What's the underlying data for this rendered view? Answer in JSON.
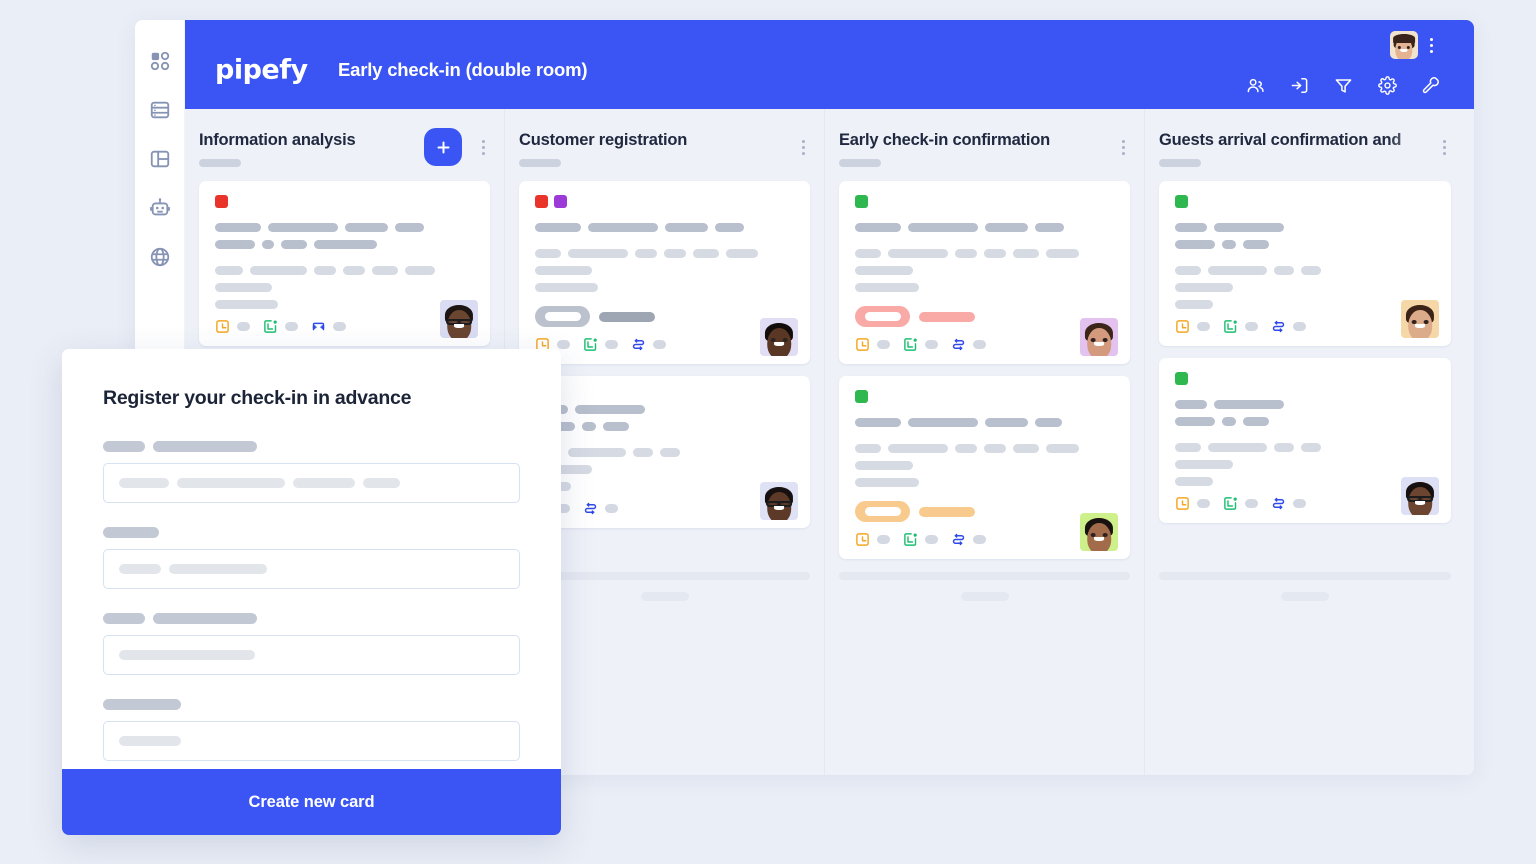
{
  "app": {
    "brand": "pipefy",
    "board_title": "Early check-in (double room)",
    "accent_color": "#3b55f4",
    "background_color": "#eaeef6",
    "board_background": "#eef1f8"
  },
  "sidebar": {
    "items": [
      {
        "icon": "grid-dashboard-icon",
        "name": "sidebar-item-dashboard"
      },
      {
        "icon": "database-icon",
        "name": "sidebar-item-database"
      },
      {
        "icon": "kanban-layout-icon",
        "name": "sidebar-item-board"
      },
      {
        "icon": "robot-automation-icon",
        "name": "sidebar-item-automation"
      },
      {
        "icon": "globe-icon",
        "name": "sidebar-item-public"
      }
    ]
  },
  "topbar": {
    "avatar_name": "user-avatar",
    "kebab_name": "board-options-kebab",
    "tools": [
      {
        "icon": "members-icon",
        "name": "tool-members"
      },
      {
        "icon": "archive-import-icon",
        "name": "tool-archive"
      },
      {
        "icon": "filter-icon",
        "name": "tool-filter"
      },
      {
        "icon": "gear-icon",
        "name": "tool-settings"
      },
      {
        "icon": "wrench-icon",
        "name": "tool-tools"
      }
    ]
  },
  "columns": [
    {
      "title": "Information analysis",
      "has_add_button": true,
      "add_label": "+",
      "truncated": false,
      "cards": [
        {
          "labels": [
            "#e8342a"
          ],
          "badge": null,
          "footer_icons": [
            "clock-square-icon",
            "calendar-check-icon",
            "connection-flow-icon"
          ],
          "avatar": "avatar-man-glasses",
          "avatar_bg": "#d9dcf2",
          "skin": "#6a4530",
          "hair": "#1d1512"
        }
      ]
    },
    {
      "title": "Customer registration",
      "has_add_button": false,
      "truncated": false,
      "cards": [
        {
          "labels": [
            "#e8342a",
            "#9b3ad6"
          ],
          "badge": {
            "color": "#b9bfcb",
            "bar_color": "#9ea6b4"
          },
          "footer_icons": [
            "clock-square-icon",
            "calendar-check-icon",
            "connection-flow-icon"
          ],
          "avatar": "avatar-man-beard",
          "avatar_bg": "#e0ddf5",
          "skin": "#5a3724",
          "hair": "#120d0a"
        },
        {
          "labels": [],
          "badge": null,
          "footer_icons": [
            "calendar-check-icon",
            "connection-flow-icon"
          ],
          "avatar": "avatar-man-glasses-2",
          "avatar_bg": "#dfe1f5",
          "skin": "#5d3a27",
          "hair": "#171010"
        }
      ]
    },
    {
      "title": "Early check-in confirmation",
      "has_add_button": false,
      "truncated": false,
      "cards": [
        {
          "labels": [
            "#2fb84f"
          ],
          "badge": {
            "color": "#f9aaa6",
            "bar_color": "#f9aaa6"
          },
          "footer_icons": [
            "clock-square-icon",
            "calendar-check-icon",
            "connection-flow-icon"
          ],
          "avatar": "avatar-man-smiling",
          "avatar_bg": "#e3c2f0",
          "skin": "#d39a7e",
          "hair": "#3b2418"
        },
        {
          "labels": [
            "#2fb84f"
          ],
          "badge": {
            "color": "#f9ca8e",
            "bar_color": "#f9ca8e"
          },
          "footer_icons": [
            "clock-square-icon",
            "calendar-check-icon",
            "connection-flow-icon"
          ],
          "avatar": "avatar-man-moustache",
          "avatar_bg": "#cdf08a",
          "skin": "#a26c4b",
          "hair": "#1a1210"
        }
      ]
    },
    {
      "title": "Guests arrival confirmation and",
      "has_add_button": false,
      "truncated": true,
      "cards": [
        {
          "labels": [
            "#2fb84f"
          ],
          "badge": null,
          "footer_icons": [
            "clock-square-icon",
            "calendar-check-icon",
            "connection-flow-icon"
          ],
          "avatar": "avatar-woman",
          "avatar_bg": "#f6d8a8",
          "skin": "#dcab8a",
          "hair": "#3b2317"
        },
        {
          "labels": [
            "#2fb84f"
          ],
          "badge": null,
          "footer_icons": [
            "clock-square-icon",
            "calendar-check-icon",
            "connection-flow-icon"
          ],
          "avatar": "avatar-man-glasses-3",
          "avatar_bg": "#dde0f4",
          "skin": "#6b452f",
          "hair": "#171010"
        }
      ]
    }
  ],
  "modal": {
    "title": "Register your check-in in advance",
    "submit_label": "Create new card",
    "fields": [
      {
        "label_widths": [
          42,
          104
        ],
        "input_widths": [
          50,
          108,
          62,
          37
        ]
      },
      {
        "label_widths": [
          56
        ],
        "input_widths": [
          42,
          98
        ]
      },
      {
        "label_widths": [
          42,
          104
        ],
        "input_widths": [
          136
        ]
      },
      {
        "label_widths": [
          78
        ],
        "input_widths": [
          62
        ]
      }
    ]
  }
}
